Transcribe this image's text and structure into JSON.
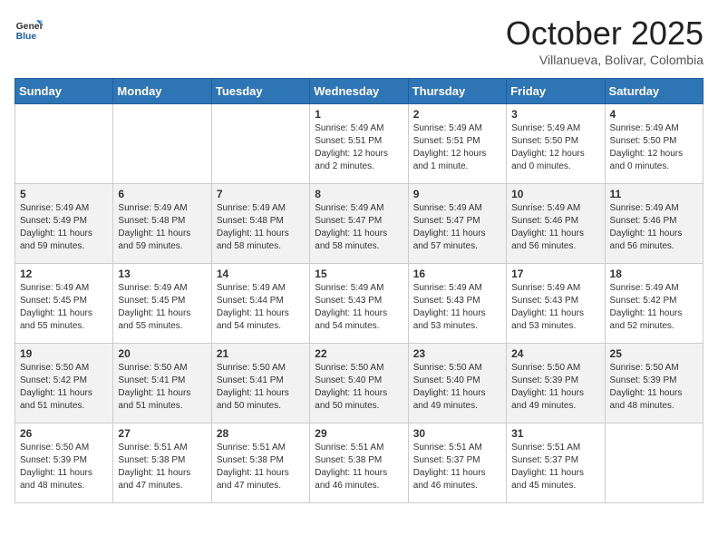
{
  "header": {
    "logo_line1": "General",
    "logo_line2": "Blue",
    "month": "October 2025",
    "location": "Villanueva, Bolivar, Colombia"
  },
  "weekdays": [
    "Sunday",
    "Monday",
    "Tuesday",
    "Wednesday",
    "Thursday",
    "Friday",
    "Saturday"
  ],
  "weeks": [
    [
      {
        "day": "",
        "info": ""
      },
      {
        "day": "",
        "info": ""
      },
      {
        "day": "",
        "info": ""
      },
      {
        "day": "1",
        "info": "Sunrise: 5:49 AM\nSunset: 5:51 PM\nDaylight: 12 hours\nand 2 minutes."
      },
      {
        "day": "2",
        "info": "Sunrise: 5:49 AM\nSunset: 5:51 PM\nDaylight: 12 hours\nand 1 minute."
      },
      {
        "day": "3",
        "info": "Sunrise: 5:49 AM\nSunset: 5:50 PM\nDaylight: 12 hours\nand 0 minutes."
      },
      {
        "day": "4",
        "info": "Sunrise: 5:49 AM\nSunset: 5:50 PM\nDaylight: 12 hours\nand 0 minutes."
      }
    ],
    [
      {
        "day": "5",
        "info": "Sunrise: 5:49 AM\nSunset: 5:49 PM\nDaylight: 11 hours\nand 59 minutes."
      },
      {
        "day": "6",
        "info": "Sunrise: 5:49 AM\nSunset: 5:48 PM\nDaylight: 11 hours\nand 59 minutes."
      },
      {
        "day": "7",
        "info": "Sunrise: 5:49 AM\nSunset: 5:48 PM\nDaylight: 11 hours\nand 58 minutes."
      },
      {
        "day": "8",
        "info": "Sunrise: 5:49 AM\nSunset: 5:47 PM\nDaylight: 11 hours\nand 58 minutes."
      },
      {
        "day": "9",
        "info": "Sunrise: 5:49 AM\nSunset: 5:47 PM\nDaylight: 11 hours\nand 57 minutes."
      },
      {
        "day": "10",
        "info": "Sunrise: 5:49 AM\nSunset: 5:46 PM\nDaylight: 11 hours\nand 56 minutes."
      },
      {
        "day": "11",
        "info": "Sunrise: 5:49 AM\nSunset: 5:46 PM\nDaylight: 11 hours\nand 56 minutes."
      }
    ],
    [
      {
        "day": "12",
        "info": "Sunrise: 5:49 AM\nSunset: 5:45 PM\nDaylight: 11 hours\nand 55 minutes."
      },
      {
        "day": "13",
        "info": "Sunrise: 5:49 AM\nSunset: 5:45 PM\nDaylight: 11 hours\nand 55 minutes."
      },
      {
        "day": "14",
        "info": "Sunrise: 5:49 AM\nSunset: 5:44 PM\nDaylight: 11 hours\nand 54 minutes."
      },
      {
        "day": "15",
        "info": "Sunrise: 5:49 AM\nSunset: 5:43 PM\nDaylight: 11 hours\nand 54 minutes."
      },
      {
        "day": "16",
        "info": "Sunrise: 5:49 AM\nSunset: 5:43 PM\nDaylight: 11 hours\nand 53 minutes."
      },
      {
        "day": "17",
        "info": "Sunrise: 5:49 AM\nSunset: 5:43 PM\nDaylight: 11 hours\nand 53 minutes."
      },
      {
        "day": "18",
        "info": "Sunrise: 5:49 AM\nSunset: 5:42 PM\nDaylight: 11 hours\nand 52 minutes."
      }
    ],
    [
      {
        "day": "19",
        "info": "Sunrise: 5:50 AM\nSunset: 5:42 PM\nDaylight: 11 hours\nand 51 minutes."
      },
      {
        "day": "20",
        "info": "Sunrise: 5:50 AM\nSunset: 5:41 PM\nDaylight: 11 hours\nand 51 minutes."
      },
      {
        "day": "21",
        "info": "Sunrise: 5:50 AM\nSunset: 5:41 PM\nDaylight: 11 hours\nand 50 minutes."
      },
      {
        "day": "22",
        "info": "Sunrise: 5:50 AM\nSunset: 5:40 PM\nDaylight: 11 hours\nand 50 minutes."
      },
      {
        "day": "23",
        "info": "Sunrise: 5:50 AM\nSunset: 5:40 PM\nDaylight: 11 hours\nand 49 minutes."
      },
      {
        "day": "24",
        "info": "Sunrise: 5:50 AM\nSunset: 5:39 PM\nDaylight: 11 hours\nand 49 minutes."
      },
      {
        "day": "25",
        "info": "Sunrise: 5:50 AM\nSunset: 5:39 PM\nDaylight: 11 hours\nand 48 minutes."
      }
    ],
    [
      {
        "day": "26",
        "info": "Sunrise: 5:50 AM\nSunset: 5:39 PM\nDaylight: 11 hours\nand 48 minutes."
      },
      {
        "day": "27",
        "info": "Sunrise: 5:51 AM\nSunset: 5:38 PM\nDaylight: 11 hours\nand 47 minutes."
      },
      {
        "day": "28",
        "info": "Sunrise: 5:51 AM\nSunset: 5:38 PM\nDaylight: 11 hours\nand 47 minutes."
      },
      {
        "day": "29",
        "info": "Sunrise: 5:51 AM\nSunset: 5:38 PM\nDaylight: 11 hours\nand 46 minutes."
      },
      {
        "day": "30",
        "info": "Sunrise: 5:51 AM\nSunset: 5:37 PM\nDaylight: 11 hours\nand 46 minutes."
      },
      {
        "day": "31",
        "info": "Sunrise: 5:51 AM\nSunset: 5:37 PM\nDaylight: 11 hours\nand 45 minutes."
      },
      {
        "day": "",
        "info": ""
      }
    ]
  ]
}
